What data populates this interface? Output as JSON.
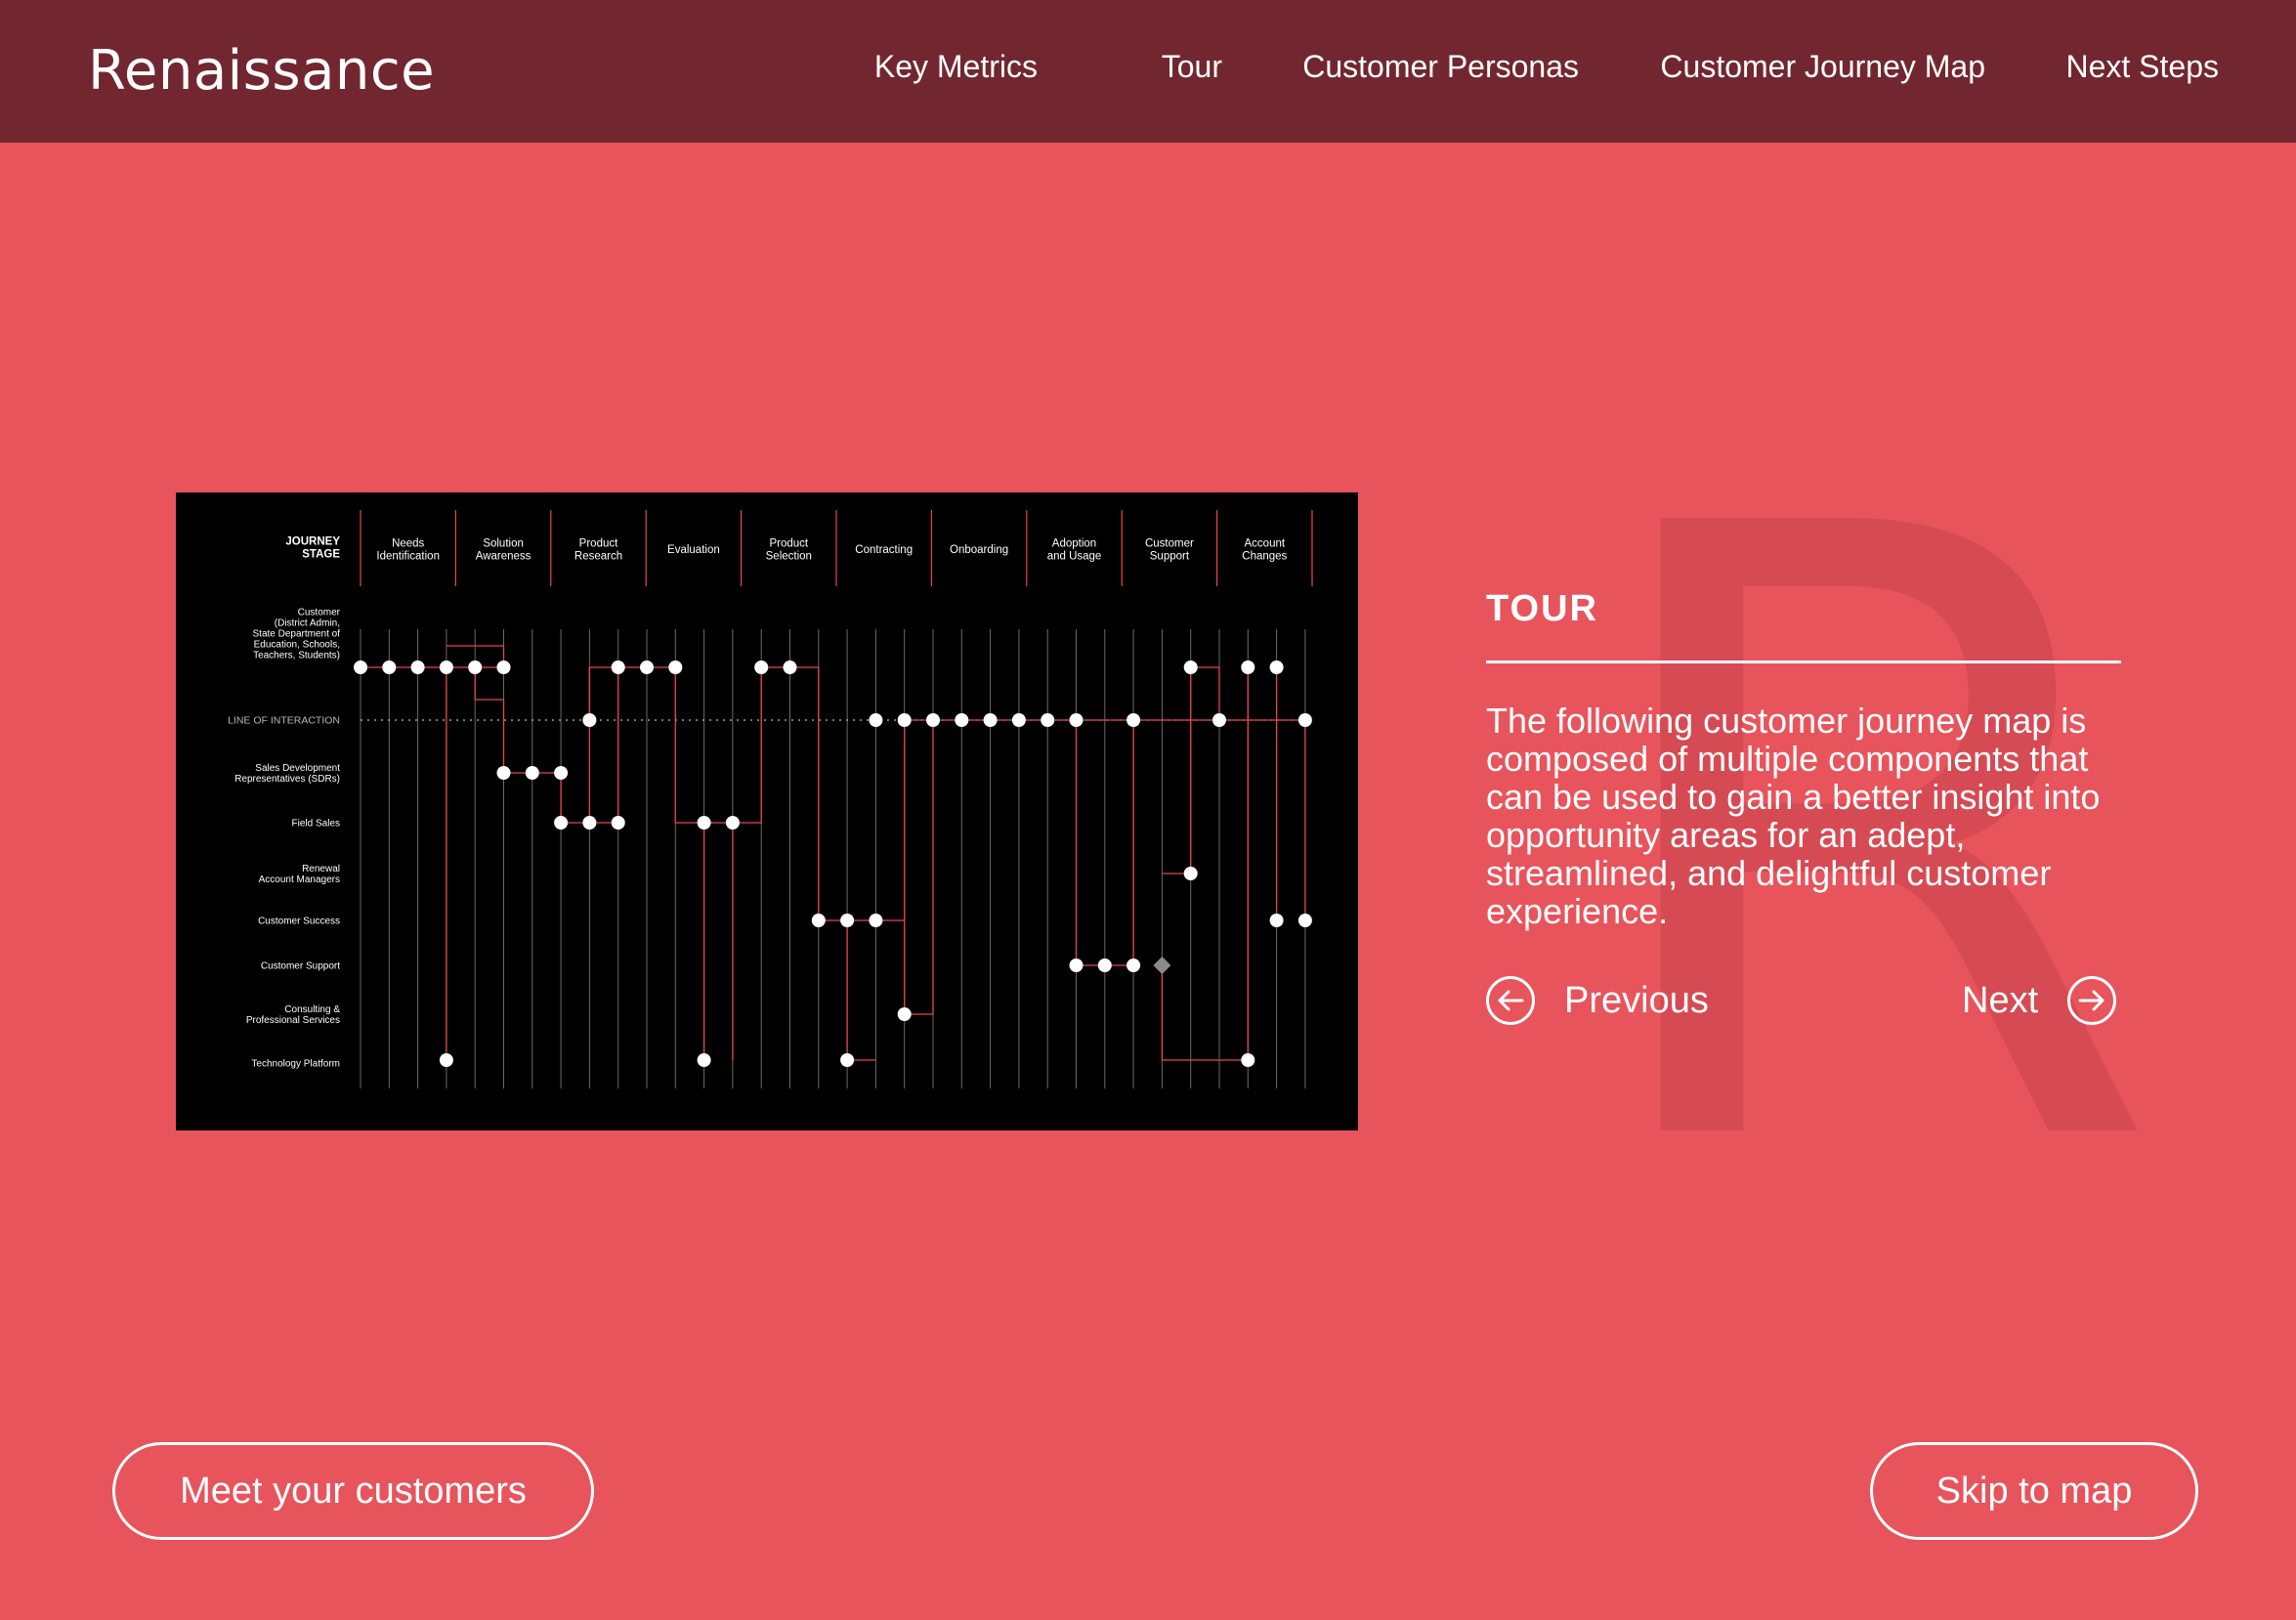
{
  "header": {
    "logo_text": "Renaissance",
    "nav": [
      "Key Metrics",
      "Tour",
      "Customer Personas",
      "Customer Journey Map",
      "Next Steps"
    ]
  },
  "journey_map": {
    "stage_header": [
      "JOURNEY",
      "STAGE"
    ],
    "stages": [
      [
        "Needs",
        "Identification"
      ],
      [
        "Solution",
        "Awareness"
      ],
      [
        "Product",
        "Research"
      ],
      [
        "Evaluation"
      ],
      [
        "Product",
        "Selection"
      ],
      [
        "Contracting"
      ],
      [
        "Onboarding"
      ],
      [
        "Adoption",
        "and Usage"
      ],
      [
        "Customer",
        "Support"
      ],
      [
        "Account",
        "Changes"
      ]
    ],
    "rows": [
      [
        "Customer",
        "(District Admin,",
        "State Department of",
        "Education, Schools,",
        "Teachers, Students)"
      ],
      [
        "LINE OF INTERACTION"
      ],
      [
        "Sales Development",
        "Representatives (SDRs)"
      ],
      [
        "Field Sales"
      ],
      [
        "Renewal",
        "Account Managers"
      ],
      [
        "Customer Success"
      ],
      [
        "Customer Support"
      ],
      [
        "Consulting &",
        "Professional Services"
      ],
      [
        "Technology Platform"
      ]
    ]
  },
  "tour": {
    "title": "TOUR",
    "body": "The following customer journey map is composed of multiple components that can be used to gain a better insight into opportunity areas for an adept, streamlined, and delightful customer experience.",
    "previous_label": "Previous",
    "next_label": "Next",
    "watermark_letter": "R"
  },
  "actions": {
    "meet_label": "Meet your customers",
    "skip_label": "Skip to map"
  },
  "colors": {
    "background": "#e8545c",
    "header": "#722730",
    "accent_line": "#e8454f"
  }
}
